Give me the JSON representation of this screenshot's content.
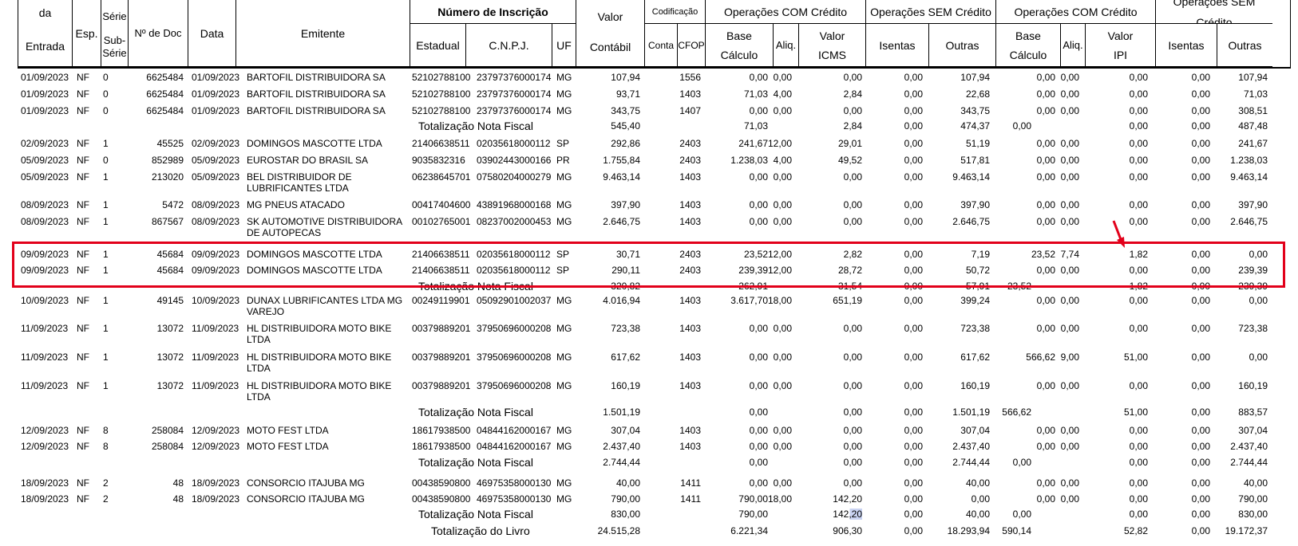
{
  "header": {
    "da": "da",
    "entrada": "Entrada",
    "esp": "Esp.",
    "serie": "Série",
    "subserie": "Sub-\nSérie",
    "ndoc": "Nº de Doc",
    "data": "Data",
    "emitente": "Emitente",
    "numero_inscricao": "Número de Inscrição",
    "estadual": "Estadual",
    "cnpj": "C.N.P.J.",
    "uf": "UF",
    "valor": "Valor",
    "contabil": "Contábil",
    "codificacao": "Codificação",
    "conta": "Conta",
    "cfop": "CFOP",
    "op_com_credito_icms": "Operações COM Crédito",
    "op_sem_credito_icms": "Operações SEM Crédito",
    "op_com_credito_ipi": "Operações COM Crédito",
    "op_sem_credito_ipi": "Operações SEM Crédito",
    "base": "Base",
    "calculo": "Cálculo",
    "aliq": "Aliq.",
    "valor_icms_1": "Valor",
    "valor_icms_2": "ICMS",
    "isentas": "Isentas",
    "outras": "Outras",
    "valor_ipi_1": "Valor",
    "valor_ipi_2": "IPI"
  },
  "rows": [
    {
      "kind": "item",
      "entrada": "01/09/2023",
      "esp": "NF",
      "serie": "0",
      "doc": "6625484",
      "data": "01/09/2023",
      "emitente": [
        "BARTOFIL DISTRIBUIDORA SA"
      ],
      "estadual": "52102788100",
      "cnpj": "23797376000174",
      "uf": "MG",
      "valor": "107,94",
      "cfop": "1556",
      "base": "0,00",
      "aliq": "0,00",
      "icms": "0,00",
      "isentas": "0,00",
      "outras": "107,94",
      "ipi_base": "0,00",
      "ipi_aliq": "0,00",
      "ipi_valor": "0,00",
      "ipi_isentas": "0,00",
      "ipi_outras": "107,94"
    },
    {
      "kind": "item",
      "entrada": "01/09/2023",
      "esp": "NF",
      "serie": "0",
      "doc": "6625484",
      "data": "01/09/2023",
      "emitente": [
        "BARTOFIL DISTRIBUIDORA SA"
      ],
      "estadual": "52102788100",
      "cnpj": "23797376000174",
      "uf": "MG",
      "valor": "93,71",
      "cfop": "1403",
      "base": "71,03",
      "aliq": "4,00",
      "icms": "2,84",
      "isentas": "0,00",
      "outras": "22,68",
      "ipi_base": "0,00",
      "ipi_aliq": "0,00",
      "ipi_valor": "0,00",
      "ipi_isentas": "0,00",
      "ipi_outras": "71,03"
    },
    {
      "kind": "item",
      "entrada": "01/09/2023",
      "esp": "NF",
      "serie": "0",
      "doc": "6625484",
      "data": "01/09/2023",
      "emitente": [
        "BARTOFIL DISTRIBUIDORA SA"
      ],
      "estadual": "52102788100",
      "cnpj": "23797376000174",
      "uf": "MG",
      "valor": "343,75",
      "cfop": "1407",
      "base": "0,00",
      "aliq": "0,00",
      "icms": "0,00",
      "isentas": "0,00",
      "outras": "343,75",
      "ipi_base": "0,00",
      "ipi_aliq": "0,00",
      "ipi_valor": "0,00",
      "ipi_isentas": "0,00",
      "ipi_outras": "308,51"
    },
    {
      "kind": "total",
      "label": "Totalização Nota Fiscal",
      "valor": "545,40",
      "base": "71,03",
      "icms": "2,84",
      "isentas": "0,00",
      "outras": "474,37",
      "ipi_base": "0,00",
      "ipi_valor": "0,00",
      "ipi_isentas": "0,00",
      "ipi_outras": "487,48"
    },
    {
      "kind": "item",
      "entrada": "02/09/2023",
      "esp": "NF",
      "serie": "1",
      "doc": "45525",
      "data": "02/09/2023",
      "emitente": [
        "DOMINGOS MASCOTTE LTDA"
      ],
      "estadual": "21406638511",
      "cnpj": "02035618000112",
      "uf": "SP",
      "valor": "292,86",
      "cfop": "2403",
      "base": "241,67",
      "aliq": "12,00",
      "icms": "29,01",
      "isentas": "0,00",
      "outras": "51,19",
      "ipi_base": "0,00",
      "ipi_aliq": "0,00",
      "ipi_valor": "0,00",
      "ipi_isentas": "0,00",
      "ipi_outras": "241,67"
    },
    {
      "kind": "item",
      "entrada": "05/09/2023",
      "esp": "NF",
      "serie": "0",
      "doc": "852989",
      "data": "05/09/2023",
      "emitente": [
        "EUROSTAR DO BRASIL SA"
      ],
      "estadual": "9035832316",
      "cnpj": "03902443000166",
      "uf": "PR",
      "valor": "1.755,84",
      "cfop": "2403",
      "base": "1.238,03",
      "aliq": "4,00",
      "icms": "49,52",
      "isentas": "0,00",
      "outras": "517,81",
      "ipi_base": "0,00",
      "ipi_aliq": "0,00",
      "ipi_valor": "0,00",
      "ipi_isentas": "0,00",
      "ipi_outras": "1.238,03"
    },
    {
      "kind": "item",
      "entrada": "05/09/2023",
      "esp": "NF",
      "serie": "1",
      "doc": "213020",
      "data": "05/09/2023",
      "emitente": [
        "BEL DISTRIBUIDOR DE",
        "LUBRIFICANTES LTDA"
      ],
      "estadual": "06238645701",
      "cnpj": "07580204000279",
      "uf": "MG",
      "valor": "9.463,14",
      "cfop": "1403",
      "base": "0,00",
      "aliq": "0,00",
      "icms": "0,00",
      "isentas": "0,00",
      "outras": "9.463,14",
      "ipi_base": "0,00",
      "ipi_aliq": "0,00",
      "ipi_valor": "0,00",
      "ipi_isentas": "0,00",
      "ipi_outras": "9.463,14"
    },
    {
      "kind": "item",
      "entrada": "08/09/2023",
      "esp": "NF",
      "serie": "1",
      "doc": "5472",
      "data": "08/09/2023",
      "emitente": [
        "MG PNEUS ATACADO"
      ],
      "estadual": "00417404600",
      "cnpj": "43891968000168",
      "uf": "MG",
      "valor": "397,90",
      "cfop": "1403",
      "base": "0,00",
      "aliq": "0,00",
      "icms": "0,00",
      "isentas": "0,00",
      "outras": "397,90",
      "ipi_base": "0,00",
      "ipi_aliq": "0,00",
      "ipi_valor": "0,00",
      "ipi_isentas": "0,00",
      "ipi_outras": "397,90"
    },
    {
      "kind": "item",
      "entrada": "08/09/2023",
      "esp": "NF",
      "serie": "1",
      "doc": "867567",
      "data": "08/09/2023",
      "emitente": [
        "SK AUTOMOTIVE DISTRIBUIDORA",
        "DE AUTOPECAS"
      ],
      "estadual": "00102765001",
      "cnpj": "08237002000453",
      "uf": "MG",
      "valor": "2.646,75",
      "cfop": "1403",
      "base": "0,00",
      "aliq": "0,00",
      "icms": "0,00",
      "isentas": "0,00",
      "outras": "2.646,75",
      "ipi_base": "0,00",
      "ipi_aliq": "0,00",
      "ipi_valor": "0,00",
      "ipi_isentas": "0,00",
      "ipi_outras": "2.646,75"
    },
    {
      "kind": "item",
      "entrada": "09/09/2023",
      "esp": "NF",
      "serie": "1",
      "doc": "45684",
      "data": "09/09/2023",
      "emitente": [
        "DOMINGOS MASCOTTE LTDA"
      ],
      "estadual": "21406638511",
      "cnpj": "02035618000112",
      "uf": "SP",
      "valor": "30,71",
      "cfop": "2403",
      "base": "23,52",
      "aliq": "12,00",
      "icms": "2,82",
      "isentas": "0,00",
      "outras": "7,19",
      "ipi_base": "23,52",
      "ipi_aliq": "7,74",
      "ipi_valor": "1,82",
      "ipi_isentas": "0,00",
      "ipi_outras": "0,00"
    },
    {
      "kind": "item",
      "entrada": "09/09/2023",
      "esp": "NF",
      "serie": "1",
      "doc": "45684",
      "data": "09/09/2023",
      "emitente": [
        "DOMINGOS MASCOTTE LTDA"
      ],
      "estadual": "21406638511",
      "cnpj": "02035618000112",
      "uf": "SP",
      "valor": "290,11",
      "cfop": "2403",
      "base": "239,39",
      "aliq": "12,00",
      "icms": "28,72",
      "isentas": "0,00",
      "outras": "50,72",
      "ipi_base": "0,00",
      "ipi_aliq": "0,00",
      "ipi_valor": "0,00",
      "ipi_isentas": "0,00",
      "ipi_outras": "239,39"
    },
    {
      "kind": "total",
      "label": "Totalização Nota Fiscal",
      "valor": "320,82",
      "base": "262,91",
      "icms": "31,54",
      "isentas": "0,00",
      "outras": "57,91",
      "ipi_base": "23,52",
      "ipi_valor": "1,82",
      "ipi_isentas": "0,00",
      "ipi_outras": "239,39"
    },
    {
      "kind": "item",
      "entrada": "10/09/2023",
      "esp": "NF",
      "serie": "1",
      "doc": "49145",
      "data": "10/09/2023",
      "emitente": [
        "DUNAX LUBRIFICANTES LTDA MG",
        "VAREJO"
      ],
      "estadual": "00249119901",
      "cnpj": "05092901002037",
      "uf": "MG",
      "valor": "4.016,94",
      "cfop": "1403",
      "base": "3.617,70",
      "aliq": "18,00",
      "icms": "651,19",
      "isentas": "0,00",
      "outras": "399,24",
      "ipi_base": "0,00",
      "ipi_aliq": "0,00",
      "ipi_valor": "0,00",
      "ipi_isentas": "0,00",
      "ipi_outras": "0,00"
    },
    {
      "kind": "item",
      "entrada": "11/09/2023",
      "esp": "NF",
      "serie": "1",
      "doc": "13072",
      "data": "11/09/2023",
      "emitente": [
        "HL DISTRIBUIDORA MOTO BIKE",
        "LTDA"
      ],
      "estadual": "00379889201",
      "cnpj": "37950696000208",
      "uf": "MG",
      "valor": "723,38",
      "cfop": "1403",
      "base": "0,00",
      "aliq": "0,00",
      "icms": "0,00",
      "isentas": "0,00",
      "outras": "723,38",
      "ipi_base": "0,00",
      "ipi_aliq": "0,00",
      "ipi_valor": "0,00",
      "ipi_isentas": "0,00",
      "ipi_outras": "723,38"
    },
    {
      "kind": "item",
      "entrada": "11/09/2023",
      "esp": "NF",
      "serie": "1",
      "doc": "13072",
      "data": "11/09/2023",
      "emitente": [
        "HL DISTRIBUIDORA MOTO BIKE",
        "LTDA"
      ],
      "estadual": "00379889201",
      "cnpj": "37950696000208",
      "uf": "MG",
      "valor": "617,62",
      "cfop": "1403",
      "base": "0,00",
      "aliq": "0,00",
      "icms": "0,00",
      "isentas": "0,00",
      "outras": "617,62",
      "ipi_base": "566,62",
      "ipi_aliq": "9,00",
      "ipi_valor": "51,00",
      "ipi_isentas": "0,00",
      "ipi_outras": "0,00"
    },
    {
      "kind": "item",
      "entrada": "11/09/2023",
      "esp": "NF",
      "serie": "1",
      "doc": "13072",
      "data": "11/09/2023",
      "emitente": [
        "HL DISTRIBUIDORA MOTO BIKE",
        "LTDA"
      ],
      "estadual": "00379889201",
      "cnpj": "37950696000208",
      "uf": "MG",
      "valor": "160,19",
      "cfop": "1403",
      "base": "0,00",
      "aliq": "0,00",
      "icms": "0,00",
      "isentas": "0,00",
      "outras": "160,19",
      "ipi_base": "0,00",
      "ipi_aliq": "0,00",
      "ipi_valor": "0,00",
      "ipi_isentas": "0,00",
      "ipi_outras": "160,19"
    },
    {
      "kind": "total",
      "label": "Totalização Nota Fiscal",
      "valor": "1.501,19",
      "base": "0,00",
      "icms": "0,00",
      "isentas": "0,00",
      "outras": "1.501,19",
      "ipi_base": "566,62",
      "ipi_valor": "51,00",
      "ipi_isentas": "0,00",
      "ipi_outras": "883,57"
    },
    {
      "kind": "item",
      "entrada": "12/09/2023",
      "esp": "NF",
      "serie": "8",
      "doc": "258084",
      "data": "12/09/2023",
      "emitente": [
        "MOTO FEST LTDA"
      ],
      "estadual": "18617938500",
      "cnpj": "04844162000167",
      "uf": "MG",
      "valor": "307,04",
      "cfop": "1403",
      "base": "0,00",
      "aliq": "0,00",
      "icms": "0,00",
      "isentas": "0,00",
      "outras": "307,04",
      "ipi_base": "0,00",
      "ipi_aliq": "0,00",
      "ipi_valor": "0,00",
      "ipi_isentas": "0,00",
      "ipi_outras": "307,04"
    },
    {
      "kind": "item",
      "entrada": "12/09/2023",
      "esp": "NF",
      "serie": "8",
      "doc": "258084",
      "data": "12/09/2023",
      "emitente": [
        "MOTO FEST LTDA"
      ],
      "estadual": "18617938500",
      "cnpj": "04844162000167",
      "uf": "MG",
      "valor": "2.437,40",
      "cfop": "1403",
      "base": "0,00",
      "aliq": "0,00",
      "icms": "0,00",
      "isentas": "0,00",
      "outras": "2.437,40",
      "ipi_base": "0,00",
      "ipi_aliq": "0,00",
      "ipi_valor": "0,00",
      "ipi_isentas": "0,00",
      "ipi_outras": "2.437,40"
    },
    {
      "kind": "total",
      "label": "Totalização Nota Fiscal",
      "valor": "2.744,44",
      "base": "0,00",
      "icms": "0,00",
      "isentas": "0,00",
      "outras": "2.744,44",
      "ipi_base": "0,00",
      "ipi_valor": "0,00",
      "ipi_isentas": "0,00",
      "ipi_outras": "2.744,44"
    },
    {
      "kind": "item",
      "entrada": "18/09/2023",
      "esp": "NF",
      "serie": "2",
      "doc": "48",
      "data": "18/09/2023",
      "emitente": [
        "CONSORCIO ITAJUBA MG"
      ],
      "estadual": "00438590800",
      "cnpj": "46975358000130",
      "uf": "MG",
      "valor": "40,00",
      "cfop": "1411",
      "base": "0,00",
      "aliq": "0,00",
      "icms": "0,00",
      "isentas": "0,00",
      "outras": "40,00",
      "ipi_base": "0,00",
      "ipi_aliq": "0,00",
      "ipi_valor": "0,00",
      "ipi_isentas": "0,00",
      "ipi_outras": "40,00"
    },
    {
      "kind": "item",
      "entrada": "18/09/2023",
      "esp": "NF",
      "serie": "2",
      "doc": "48",
      "data": "18/09/2023",
      "emitente": [
        "CONSORCIO ITAJUBA MG"
      ],
      "estadual": "00438590800",
      "cnpj": "46975358000130",
      "uf": "MG",
      "valor": "790,00",
      "cfop": "1411",
      "base": "790,00",
      "aliq": "18,00",
      "icms": "142,20",
      "isentas": "0,00",
      "outras": "0,00",
      "ipi_base": "0,00",
      "ipi_aliq": "0,00",
      "ipi_valor": "0,00",
      "ipi_isentas": "0,00",
      "ipi_outras": "790,00"
    },
    {
      "kind": "total",
      "label": "Totalização Nota Fiscal",
      "valor": "830,00",
      "base": "790,00",
      "icms": "142,20",
      "icms_selected": true,
      "isentas": "0,00",
      "outras": "40,00",
      "ipi_base": "0,00",
      "ipi_valor": "0,00",
      "ipi_isentas": "0,00",
      "ipi_outras": "830,00"
    },
    {
      "kind": "book",
      "label": "Totalização do Livro",
      "valor": "24.515,28",
      "base": "6.221,34",
      "icms": "906,30",
      "isentas": "0,00",
      "outras": "18.293,94",
      "ipi_base": "590,14",
      "ipi_valor": "52,82",
      "ipi_isentas": "0,00",
      "ipi_outras": "19.172,37"
    }
  ],
  "highlight_color": "#e2001a",
  "selection_color": "#c9d3f2"
}
